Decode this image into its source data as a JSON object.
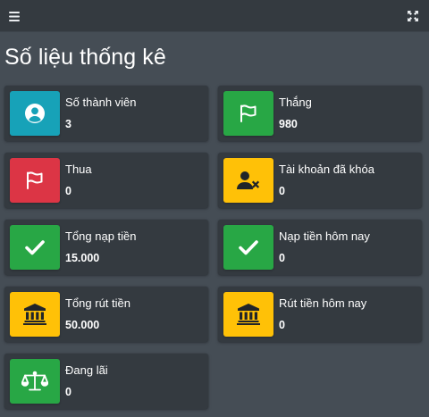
{
  "page": {
    "title": "Số liệu thống kê"
  },
  "topbar": {
    "menu_icon": "bars-icon",
    "fullscreen_icon": "expand-arrows-icon"
  },
  "colors": {
    "info": "#17a2b8",
    "success": "#28a745",
    "danger": "#dc3545",
    "warning": "#ffc107",
    "card_bg": "#343a40",
    "page_bg": "#454d55"
  },
  "stats": [
    {
      "label": "Số thành viên",
      "value": "3",
      "icon": "user-circle-icon",
      "color": "info"
    },
    {
      "label": "Thắng",
      "value": "980",
      "icon": "flag-icon",
      "color": "success"
    },
    {
      "label": "Thua",
      "value": "0",
      "icon": "flag-icon",
      "color": "danger"
    },
    {
      "label": "Tài khoản đã khóa",
      "value": "0",
      "icon": "user-times-icon",
      "color": "warning"
    },
    {
      "label": "Tổng nạp tiền",
      "value": "15.000",
      "icon": "check-icon",
      "color": "success"
    },
    {
      "label": "Nạp tiền hôm nay",
      "value": "0",
      "icon": "check-icon",
      "color": "success"
    },
    {
      "label": "Tổng rút tiền",
      "value": "50.000",
      "icon": "bank-icon",
      "color": "warning"
    },
    {
      "label": "Rút tiền hôm nay",
      "value": "0",
      "icon": "bank-icon",
      "color": "warning"
    },
    {
      "label": "Đang lãi",
      "value": "0",
      "icon": "balance-scale-icon",
      "color": "success"
    }
  ]
}
